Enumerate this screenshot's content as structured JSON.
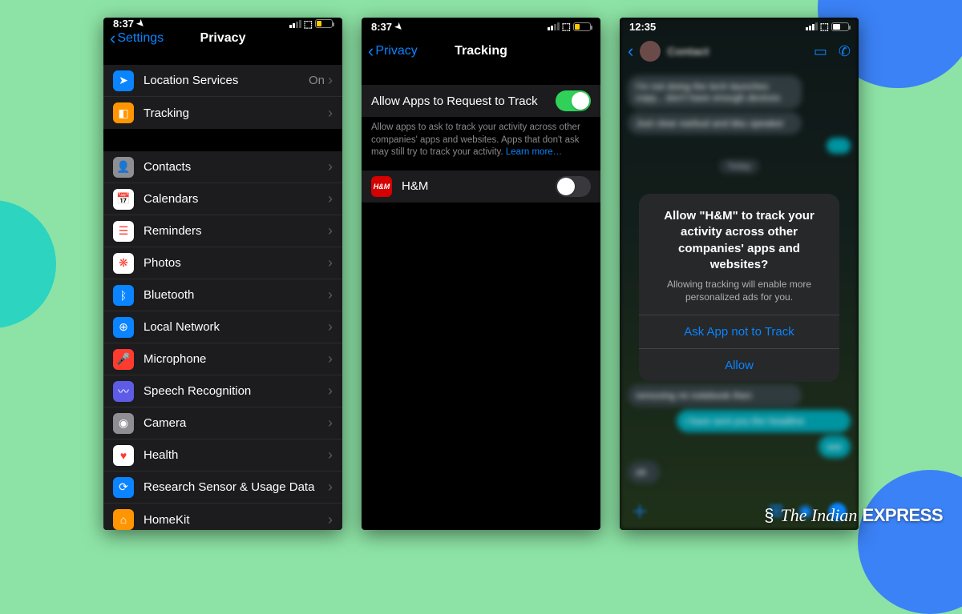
{
  "status": {
    "time1": "8:37",
    "time2": "8:37",
    "time3": "12:35"
  },
  "phone1": {
    "back_label": "Settings",
    "title": "Privacy",
    "group1": [
      {
        "label": "Location Services",
        "detail": "On",
        "icon_bg": "#0a84ff",
        "icon_glyph": "➤"
      },
      {
        "label": "Tracking",
        "detail": "",
        "icon_bg": "#ff9500",
        "icon_glyph": "◧"
      }
    ],
    "group2": [
      {
        "label": "Contacts",
        "icon_bg": "#8e8e93",
        "icon_glyph": "👤"
      },
      {
        "label": "Calendars",
        "icon_bg": "#ffffff",
        "icon_glyph": "📅"
      },
      {
        "label": "Reminders",
        "icon_bg": "#ffffff",
        "icon_glyph": "☰"
      },
      {
        "label": "Photos",
        "icon_bg": "#ffffff",
        "icon_glyph": "❋"
      },
      {
        "label": "Bluetooth",
        "icon_bg": "#0a84ff",
        "icon_glyph": "ᛒ"
      },
      {
        "label": "Local Network",
        "icon_bg": "#0a84ff",
        "icon_glyph": "⊕"
      },
      {
        "label": "Microphone",
        "icon_bg": "#ff3b30",
        "icon_glyph": "🎤"
      },
      {
        "label": "Speech Recognition",
        "icon_bg": "#5e5ce6",
        "icon_glyph": "〰"
      },
      {
        "label": "Camera",
        "icon_bg": "#8e8e93",
        "icon_glyph": "◉"
      },
      {
        "label": "Health",
        "icon_bg": "#ffffff",
        "icon_glyph": "♥"
      },
      {
        "label": "Research Sensor & Usage Data",
        "icon_bg": "#0a84ff",
        "icon_glyph": "⟳"
      },
      {
        "label": "HomeKit",
        "icon_bg": "#ff9500",
        "icon_glyph": "⌂"
      }
    ]
  },
  "phone2": {
    "back_label": "Privacy",
    "title": "Tracking",
    "master_row_label": "Allow Apps to Request to Track",
    "footer_note": "Allow apps to ask to track your activity across other companies' apps and websites. Apps that don't ask may still try to track your activity. ",
    "footer_link": "Learn more…",
    "app_row": {
      "label": "H&M",
      "icon_bg": "#d50000",
      "icon_text": "H&M"
    }
  },
  "phone3": {
    "day_label": "Today",
    "alert_title": "Allow \"H&M\" to track your activity across other companies' apps and websites?",
    "alert_message": "Allowing tracking will enable more personalized ads for you.",
    "alert_btn1": "Ask App not to Track",
    "alert_btn2": "Allow"
  },
  "watermark": {
    "prefix": "The Indian",
    "suffix": "EXPRESS"
  }
}
